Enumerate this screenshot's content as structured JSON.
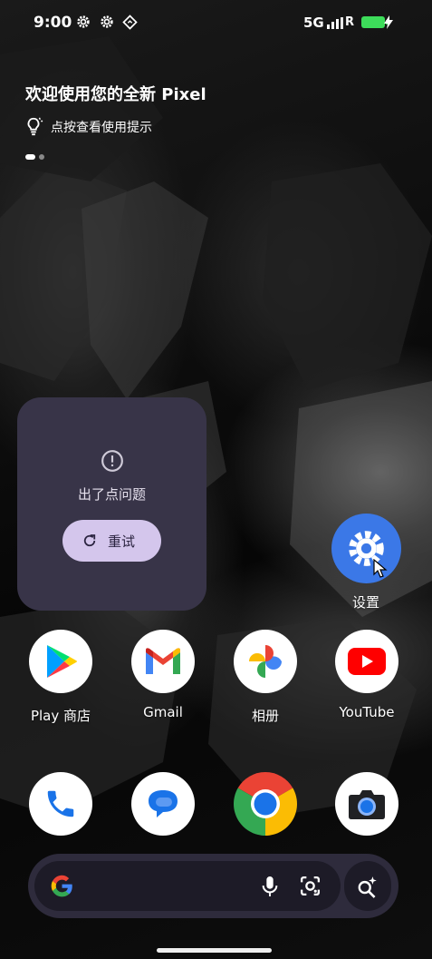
{
  "status_bar": {
    "time": "9:00",
    "icons": [
      "settings-gear-icon",
      "settings-gear-icon",
      "location-diamond-icon"
    ],
    "network": "5G",
    "signal_label": "R",
    "battery": "charging"
  },
  "welcome": {
    "title": "欢迎使用您的全新 Pixel",
    "tip": "点按查看使用提示",
    "page_indicator": {
      "pages": 2,
      "active": 1
    }
  },
  "error_widget": {
    "message": "出了点问题",
    "retry_label": "重试"
  },
  "apps": {
    "settings": {
      "label": "设置",
      "icon": "settings-gear-icon"
    },
    "row1": [
      {
        "label": "Play 商店",
        "icon": "play-store-icon"
      },
      {
        "label": "Gmail",
        "icon": "gmail-icon"
      },
      {
        "label": "相册",
        "icon": "photos-icon"
      },
      {
        "label": "YouTube",
        "icon": "youtube-icon"
      }
    ],
    "dock": [
      {
        "icon": "phone-icon"
      },
      {
        "icon": "messages-icon"
      },
      {
        "icon": "chrome-icon"
      },
      {
        "icon": "camera-icon"
      }
    ]
  },
  "search_bar": {
    "icons": [
      "google-g-icon",
      "microphone-icon",
      "lens-icon",
      "ai-sparkle-search-icon"
    ]
  },
  "colors": {
    "widget_bg": "#383448",
    "retry_bg": "#d4c6ec",
    "battery": "#3ddc5a",
    "settings_blue": "#3b78e7",
    "search_bg": "#2e2b3c"
  }
}
